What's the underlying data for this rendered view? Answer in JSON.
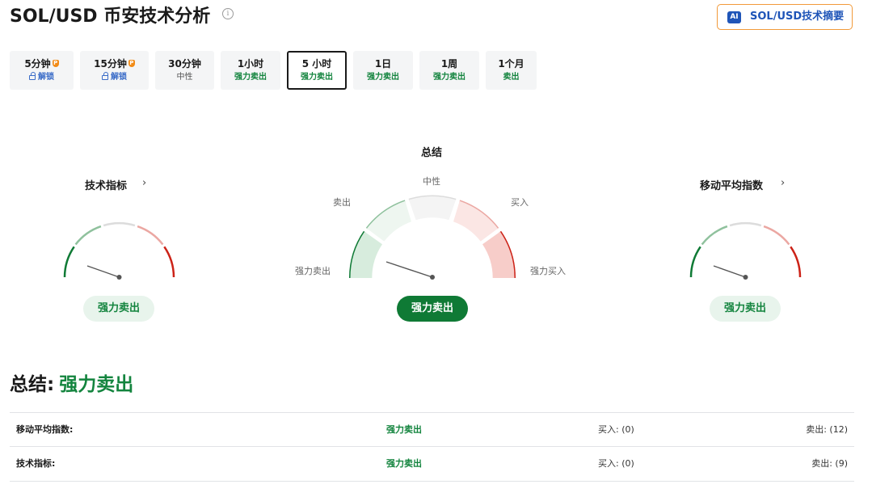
{
  "header": {
    "title": "SOL/USD 币安技术分析",
    "info_icon": "info-circle-icon",
    "ai_badge": "AI",
    "ai_button_label": "SOL/USD技术摘要"
  },
  "timeframes": [
    {
      "label": "5分钟",
      "status": "解锁",
      "kind": "lock",
      "pro": true
    },
    {
      "label": "15分钟",
      "status": "解锁",
      "kind": "lock",
      "pro": true
    },
    {
      "label": "30分钟",
      "status": "中性",
      "kind": "neutral"
    },
    {
      "label": "1小时",
      "status": "强力卖出",
      "kind": "sell"
    },
    {
      "label": "5 小时",
      "status": "强力卖出",
      "kind": "sell",
      "active": true
    },
    {
      "label": "1日",
      "status": "强力卖出",
      "kind": "sell"
    },
    {
      "label": "1周",
      "status": "强力卖出",
      "kind": "sell"
    },
    {
      "label": "1个月",
      "status": "卖出",
      "kind": "sell"
    }
  ],
  "gauges": {
    "technical": {
      "title": "技术指标",
      "verdict": "强力卖出",
      "needle": "strong-sell"
    },
    "summary": {
      "title": "总结",
      "verdict": "强力卖出",
      "needle": "strong-sell",
      "scale": {
        "strong_sell": "强力卖出",
        "sell": "卖出",
        "neutral": "中性",
        "buy": "买入",
        "strong_buy": "强力买入"
      }
    },
    "moving_averages": {
      "title": "移动平均指数",
      "verdict": "强力卖出",
      "needle": "strong-sell"
    }
  },
  "colors": {
    "strong_sell": "#0f7a35",
    "sell": "#8fc19d",
    "neutral": "#dcdcdc",
    "buy": "#eba7a2",
    "strong_buy": "#cc2217",
    "accent_blue": "#1f55b8",
    "ai_border": "#f29a3a"
  },
  "summary": {
    "heading": "总结:",
    "verdict": "强力卖出",
    "rows": [
      {
        "name": "移动平均指数:",
        "verdict": "强力卖出",
        "buy": "买入: (0)",
        "sell": "卖出: (12)"
      },
      {
        "name": "技术指标:",
        "verdict": "强力卖出",
        "buy": "买入: (0)",
        "sell": "卖出: (9)"
      }
    ]
  }
}
